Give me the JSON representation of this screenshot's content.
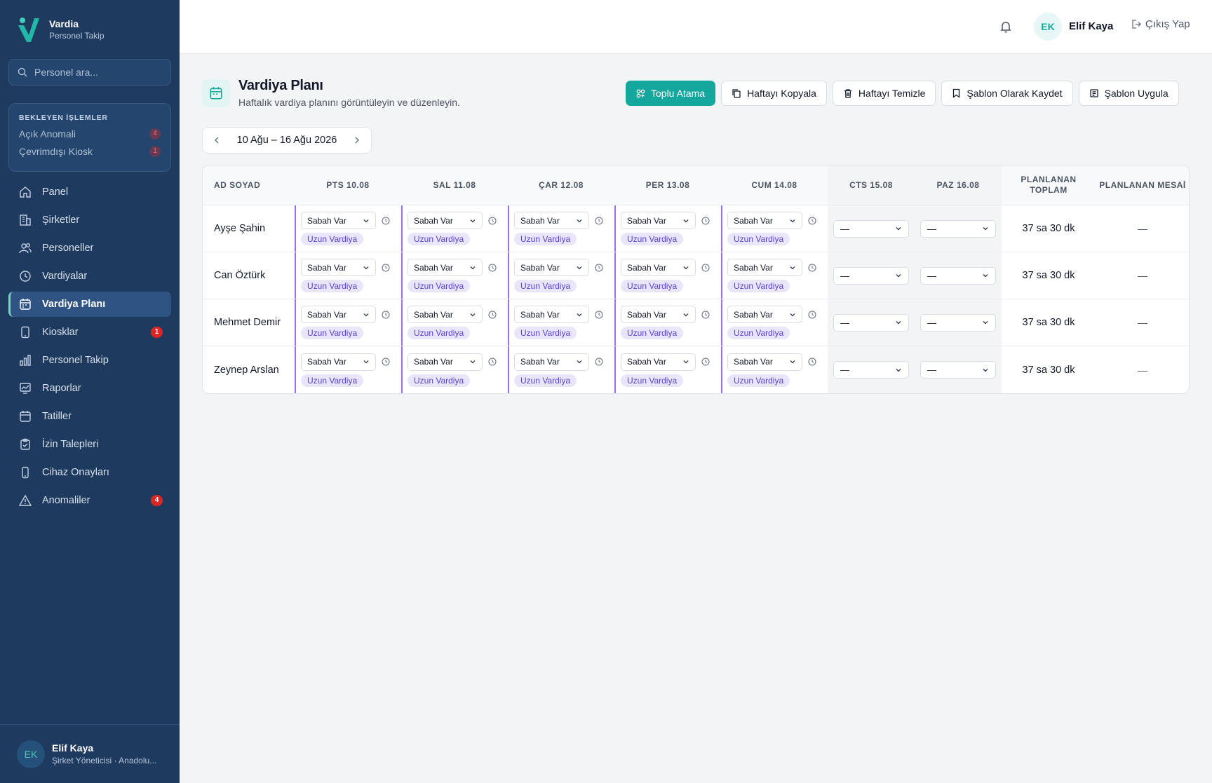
{
  "brand": {
    "name": "Vardia",
    "subtitle": "Personel Takip",
    "logo_icon": "v-logo-icon"
  },
  "sidebar": {
    "search_placeholder": "Personel ara...",
    "pending": {
      "title": "BEKLEYEN İŞLEMLER",
      "items": [
        {
          "label": "Açık Anomali",
          "count": "4"
        },
        {
          "label": "Çevrimdışı Kiosk",
          "count": "1"
        }
      ]
    },
    "nav": [
      {
        "label": "Panel",
        "icon": "home-icon",
        "active": false,
        "badge": ""
      },
      {
        "label": "Şirketler",
        "icon": "building-icon",
        "active": false,
        "badge": ""
      },
      {
        "label": "Personeller",
        "icon": "users-icon",
        "active": false,
        "badge": ""
      },
      {
        "label": "Vardiyalar",
        "icon": "clock-icon",
        "active": false,
        "badge": ""
      },
      {
        "label": "Vardiya Planı",
        "icon": "calendar-icon",
        "active": true,
        "badge": ""
      },
      {
        "label": "Kiosklar",
        "icon": "tablet-icon",
        "active": false,
        "badge": "1"
      },
      {
        "label": "Personel Takip",
        "icon": "bar-chart-icon",
        "active": false,
        "badge": ""
      },
      {
        "label": "Raporlar",
        "icon": "report-icon",
        "active": false,
        "badge": ""
      },
      {
        "label": "Tatiller",
        "icon": "calendar-blank-icon",
        "active": false,
        "badge": ""
      },
      {
        "label": "İzin Talepleri",
        "icon": "clipboard-icon",
        "active": false,
        "badge": ""
      },
      {
        "label": "Cihaz Onayları",
        "icon": "phone-icon",
        "active": false,
        "badge": ""
      },
      {
        "label": "Anomaliler",
        "icon": "warning-icon",
        "active": false,
        "badge": "4"
      }
    ],
    "user": {
      "initials": "EK",
      "name": "Elif Kaya",
      "role": "Şirket Yöneticisi · Anadolu..."
    }
  },
  "topbar": {
    "initials": "EK",
    "user_name": "Elif Kaya",
    "logout_label": "Çıkış Yap"
  },
  "page": {
    "title": "Vardiya Planı",
    "subtitle": "Haftalık vardiya planını görüntüleyin ve düzenleyin.",
    "actions": {
      "bulk": "Toplu Atama",
      "copy": "Haftayı Kopyala",
      "clear": "Haftayı Temizle",
      "save_template": "Şablon Olarak Kaydet",
      "apply_template": "Şablon Uygula"
    },
    "week_range": "10 Ağu – 16 Ağu 2026"
  },
  "table": {
    "headers": {
      "name": "AD SOYAD",
      "days": [
        "PTS 10.08",
        "SAL 11.08",
        "ÇAR 12.08",
        "PER 13.08",
        "CUM 14.08"
      ],
      "weekend": [
        "CTS 15.08",
        "PAZ 16.08"
      ],
      "total": "PLANLANAN TOPLAM",
      "overtime": "PLANLANAN MESAİ"
    },
    "shift_value": "Sabah Var",
    "shift_tag": "Uzun Vardiya",
    "empty_value": "—",
    "rows": [
      {
        "name": "Ayşe Şahin",
        "total": "37 sa 30 dk",
        "overtime": "—"
      },
      {
        "name": "Can Öztürk",
        "total": "37 sa 30 dk",
        "overtime": "—"
      },
      {
        "name": "Mehmet Demir",
        "total": "37 sa 30 dk",
        "overtime": "—"
      },
      {
        "name": "Zeynep Arslan",
        "total": "37 sa 30 dk",
        "overtime": "—"
      }
    ]
  },
  "colors": {
    "sidebar": "#1e3a5f",
    "accent": "#14a79d",
    "day_border": "#9b6ff0",
    "tag_bg": "#e9e6fb",
    "badge": "#dc2626"
  }
}
